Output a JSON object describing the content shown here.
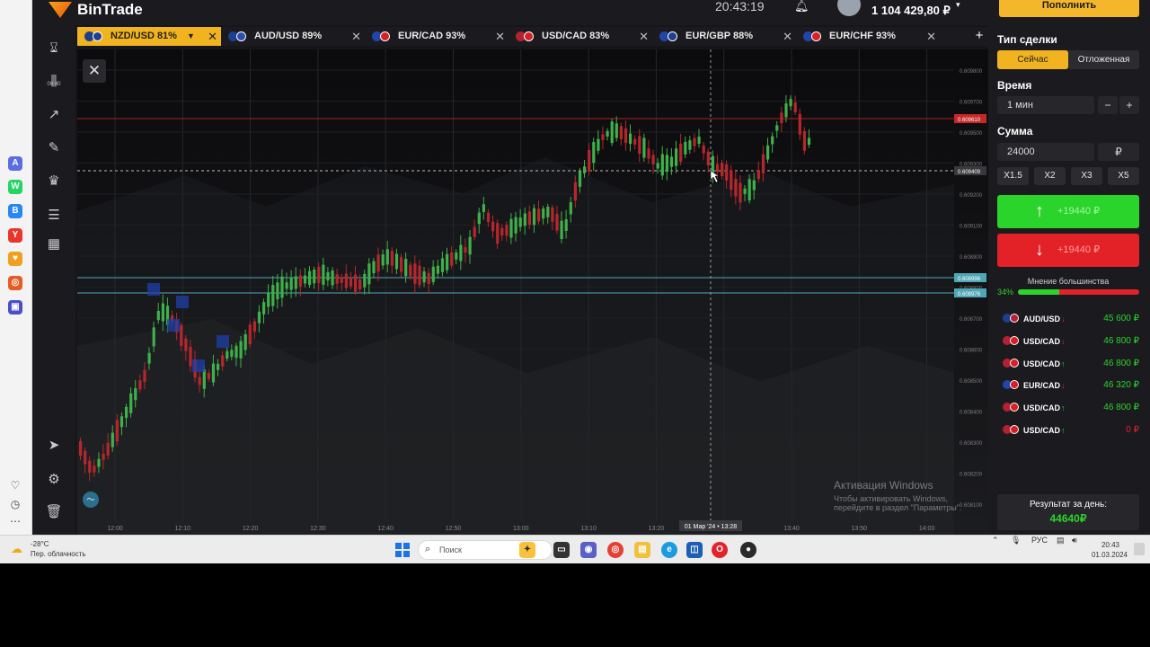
{
  "app": {
    "name": "BinTrade",
    "clock": "20:43:19",
    "balance": "1 104 429,80 ₽",
    "deposit_label": "Пополнить",
    "timer_label": "00:40"
  },
  "tabs": [
    {
      "label": "NZD/USD 81%",
      "active": true,
      "flags": [
        "#1d3f8f",
        "#1d3f8f"
      ]
    },
    {
      "label": "AUD/USD 89%",
      "active": false,
      "flags": [
        "#1d3f8f",
        "#2a4fb0"
      ]
    },
    {
      "label": "EUR/CAD 93%",
      "active": false,
      "flags": [
        "#2246a8",
        "#d91f26"
      ]
    },
    {
      "label": "USD/CAD 83%",
      "active": false,
      "flags": [
        "#b22234",
        "#d91f26"
      ]
    },
    {
      "label": "EUR/GBP 88%",
      "active": false,
      "flags": [
        "#2246a8",
        "#1d3f8f"
      ]
    },
    {
      "label": "EUR/CHF 93%",
      "active": false,
      "flags": [
        "#2246a8",
        "#d91f26"
      ]
    }
  ],
  "chart": {
    "price_labels": [
      "0.609800",
      "0.609700",
      "0.609500",
      "0.609300",
      "0.609200",
      "0.609100",
      "0.608900",
      "0.608800",
      "0.608700",
      "0.608600",
      "0.608500",
      "0.608400",
      "0.608300",
      "0.608200",
      "0.608100"
    ],
    "level_upper": "0.609610",
    "level_current": "0.609409",
    "level_cyan_1": "0.608996",
    "level_cyan_2": "0.608976",
    "time_labels": [
      "12:00",
      "12:10",
      "12:20",
      "12:30",
      "12:40",
      "12:50",
      "13:00",
      "13:10",
      "13:20",
      "13:30",
      "13:40",
      "13:50",
      "14:00"
    ],
    "crosshair_label": "01 Мар '24 • 13:28"
  },
  "watermark": {
    "line1": "Активация Windows",
    "line2": "Чтобы активировать Windows, перейдите в раздел \"Параметры\"."
  },
  "panel": {
    "trade_type_title": "Тип сделки",
    "trade_type_now": "Сейчас",
    "trade_type_pending": "Отложенная",
    "time_title": "Время",
    "time_value": "1 мин",
    "time_minus": "−",
    "time_plus": "+",
    "sum_title": "Сумма",
    "sum_value": "24000",
    "currency": "₽",
    "multipliers": [
      "X1.5",
      "X2",
      "X3",
      "X5"
    ],
    "up_amount": "+19440 ₽",
    "down_amount": "+19440 ₽",
    "majority_label": "Мнение большинства",
    "majority_pct": "34%",
    "majority_fraction": 0.34,
    "day_result_label": "Результат за день:",
    "day_result_value": "44640₽"
  },
  "trades": [
    {
      "pair": "AUD/USD",
      "dir": "↓",
      "dir_color": "#e32228",
      "value": "45 600 ₽",
      "value_color": "#2bd42a",
      "flags": [
        "#1d3f8f",
        "#b22234"
      ]
    },
    {
      "pair": "USD/CAD",
      "dir": "↓",
      "dir_color": "#e32228",
      "value": "46 800 ₽",
      "value_color": "#2bd42a",
      "flags": [
        "#b22234",
        "#d91f26"
      ]
    },
    {
      "pair": "USD/CAD",
      "dir": "↑",
      "dir_color": "#2bd42a",
      "value": "46 800 ₽",
      "value_color": "#2bd42a",
      "flags": [
        "#b22234",
        "#d91f26"
      ]
    },
    {
      "pair": "EUR/CAD",
      "dir": "↓",
      "dir_color": "#e32228",
      "value": "46 320 ₽",
      "value_color": "#2bd42a",
      "flags": [
        "#2246a8",
        "#d91f26"
      ]
    },
    {
      "pair": "USD/CAD",
      "dir": "↑",
      "dir_color": "#2bd42a",
      "value": "46 800 ₽",
      "value_color": "#2bd42a",
      "flags": [
        "#b22234",
        "#d91f26"
      ]
    },
    {
      "pair": "USD/CAD",
      "dir": "↑",
      "dir_color": "#2bd42a",
      "value": "0 ₽",
      "value_color": "#e32228",
      "flags": [
        "#b22234",
        "#d91f26"
      ]
    }
  ],
  "taskbar": {
    "temp": "-28°C",
    "condition": "Пер. облачность",
    "search_placeholder": "Поиск",
    "lang": "РУС",
    "time": "20:43",
    "date": "01.03.2024"
  }
}
